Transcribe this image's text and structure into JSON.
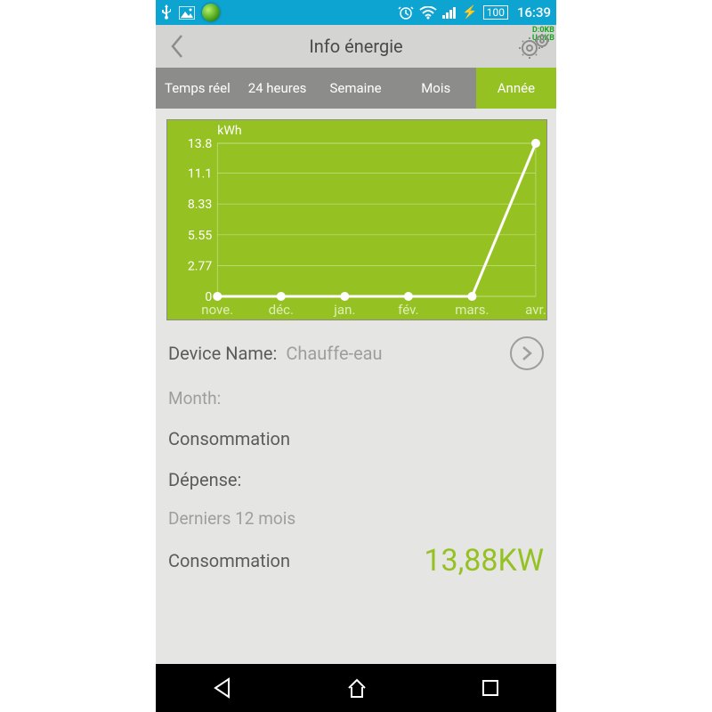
{
  "status": {
    "battery_level": "100",
    "clock": "16:39"
  },
  "header": {
    "title": "Info énergie",
    "net_down": "D:0KB",
    "net_up": "U:0KB"
  },
  "tabs": [
    "Temps réel",
    "24 heures",
    "Semaine",
    "Mois",
    "Année"
  ],
  "active_tab_index": 4,
  "chart_data": {
    "type": "line",
    "unit": "kWh",
    "categories": [
      "nove.",
      "déc.",
      "jan.",
      "fév.",
      "mars.",
      "avr."
    ],
    "values": [
      0.0,
      0.0,
      0.0,
      0.0,
      0.0,
      13.8
    ],
    "y_ticks": [
      0.0,
      2.77,
      5.55,
      8.33,
      11.1,
      13.8
    ],
    "ylim": [
      0,
      13.8
    ],
    "ylabel": "kWh"
  },
  "device": {
    "label": "Device Name:",
    "value": "Chauffe-eau"
  },
  "month_label": "Month:",
  "consumption_label": "Consommation",
  "expense_label": "Dépense:",
  "last12_label": "Derniers 12 mois",
  "total_consumption": {
    "label": "Consommation",
    "value": "13,88KW"
  }
}
